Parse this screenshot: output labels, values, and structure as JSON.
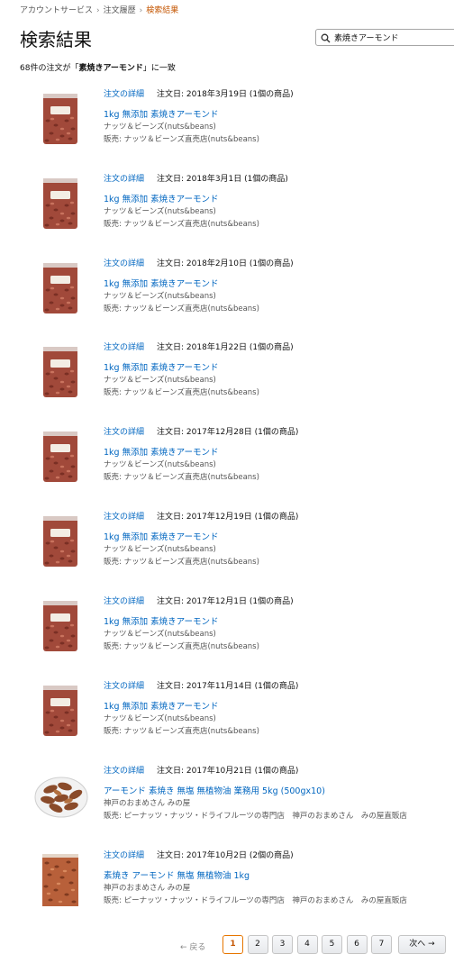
{
  "breadcrumb": [
    "アカウントサービス",
    "注文履歴",
    "検索結果"
  ],
  "page_title": "検索結果",
  "search": {
    "value": "素焼きアーモンド",
    "placeholder": ""
  },
  "summary": {
    "prefix": "68件の注文が「",
    "term": "素焼きアーモンド",
    "suffix": "」に一致"
  },
  "orders": [
    {
      "detail_label": "注文の詳細",
      "date_label": "注文日: 2018年3月19日 (1個の商品)",
      "product": "1kg 無添加 素焼きアーモンド",
      "brand": "ナッツ＆ビーンズ(nuts&beans)",
      "seller": "販売: ナッツ＆ビーンズ直売店(nuts&beans)",
      "thumb_icon": "almond-bag-icon"
    },
    {
      "detail_label": "注文の詳細",
      "date_label": "注文日: 2018年3月1日 (1個の商品)",
      "product": "1kg 無添加 素焼きアーモンド",
      "brand": "ナッツ＆ビーンズ(nuts&beans)",
      "seller": "販売: ナッツ＆ビーンズ直売店(nuts&beans)",
      "thumb_icon": "almond-bag-icon"
    },
    {
      "detail_label": "注文の詳細",
      "date_label": "注文日: 2018年2月10日 (1個の商品)",
      "product": "1kg 無添加 素焼きアーモンド",
      "brand": "ナッツ＆ビーンズ(nuts&beans)",
      "seller": "販売: ナッツ＆ビーンズ直売店(nuts&beans)",
      "thumb_icon": "almond-bag-icon"
    },
    {
      "detail_label": "注文の詳細",
      "date_label": "注文日: 2018年1月22日 (1個の商品)",
      "product": "1kg 無添加 素焼きアーモンド",
      "brand": "ナッツ＆ビーンズ(nuts&beans)",
      "seller": "販売: ナッツ＆ビーンズ直売店(nuts&beans)",
      "thumb_icon": "almond-bag-icon"
    },
    {
      "detail_label": "注文の詳細",
      "date_label": "注文日: 2017年12月28日 (1個の商品)",
      "product": "1kg 無添加 素焼きアーモンド",
      "brand": "ナッツ＆ビーンズ(nuts&beans)",
      "seller": "販売: ナッツ＆ビーンズ直売店(nuts&beans)",
      "thumb_icon": "almond-bag-icon"
    },
    {
      "detail_label": "注文の詳細",
      "date_label": "注文日: 2017年12月19日 (1個の商品)",
      "product": "1kg 無添加 素焼きアーモンド",
      "brand": "ナッツ＆ビーンズ(nuts&beans)",
      "seller": "販売: ナッツ＆ビーンズ直売店(nuts&beans)",
      "thumb_icon": "almond-bag-icon"
    },
    {
      "detail_label": "注文の詳細",
      "date_label": "注文日: 2017年12月1日 (1個の商品)",
      "product": "1kg 無添加 素焼きアーモンド",
      "brand": "ナッツ＆ビーンズ(nuts&beans)",
      "seller": "販売: ナッツ＆ビーンズ直売店(nuts&beans)",
      "thumb_icon": "almond-bag-icon"
    },
    {
      "detail_label": "注文の詳細",
      "date_label": "注文日: 2017年11月14日 (1個の商品)",
      "product": "1kg 無添加 素焼きアーモンド",
      "brand": "ナッツ＆ビーンズ(nuts&beans)",
      "seller": "販売: ナッツ＆ビーンズ直売店(nuts&beans)",
      "thumb_icon": "almond-bag-icon"
    },
    {
      "detail_label": "注文の詳細",
      "date_label": "注文日: 2017年10月21日 (1個の商品)",
      "product": "アーモンド 素焼き 無塩 無植物油 業務用 5kg (500gx10)",
      "brand": "神戸のおまめさん みの屋",
      "seller": "販売: ピーナッツ・ナッツ・ドライフルーツの専門店　神戸のおまめさん　みの屋直販店",
      "thumb_icon": "almond-bowl-icon"
    },
    {
      "detail_label": "注文の詳細",
      "date_label": "注文日: 2017年10月2日 (2個の商品)",
      "product": "素焼き アーモンド 無塩 無植物油 1kg",
      "brand": "神戸のおまめさん みの屋",
      "seller": "販売: ピーナッツ・ナッツ・ドライフルーツの専門店　神戸のおまめさん　みの屋直販店",
      "thumb_icon": "almond-pack-icon"
    }
  ],
  "pagination": {
    "prev_label": "← 戻る",
    "pages": [
      "1",
      "2",
      "3",
      "4",
      "5",
      "6",
      "7"
    ],
    "current": "1",
    "next_label": "次へ →"
  },
  "colors": {
    "link": "#0066c0",
    "accent": "#c45500",
    "active_border": "#e77600"
  }
}
